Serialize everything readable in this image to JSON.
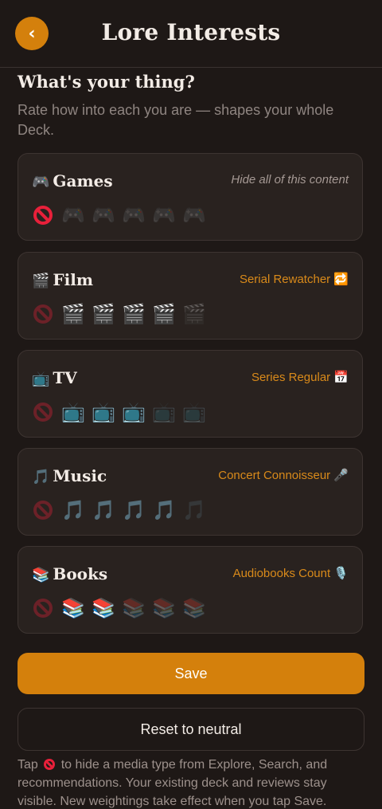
{
  "header": {
    "back_icon": "chevron-left-icon",
    "title": "Lore Interests"
  },
  "intro": {
    "title": "What's your thing?",
    "subtitle": "Rate how into each you are — shapes your whole Deck."
  },
  "categories": [
    {
      "key": "games",
      "emoji": "🎮",
      "label": "Games",
      "status": "Hide all of this content",
      "status_muted": true,
      "glyph": "🎮",
      "hidden": true,
      "level": 0,
      "max": 5
    },
    {
      "key": "film",
      "emoji": "🎬",
      "label": "Film",
      "status": "Serial Rewatcher 🔁",
      "status_muted": false,
      "glyph": "🎬",
      "hidden": false,
      "level": 4,
      "max": 5
    },
    {
      "key": "tv",
      "emoji": "📺",
      "label": "TV",
      "status": "Series Regular 📅",
      "status_muted": false,
      "glyph": "📺",
      "hidden": false,
      "level": 3,
      "max": 5
    },
    {
      "key": "music",
      "emoji": "🎵",
      "label": "Music",
      "status": "Concert Connoisseur 🎤",
      "status_muted": false,
      "glyph": "🎵",
      "hidden": false,
      "level": 4,
      "max": 5
    },
    {
      "key": "books",
      "emoji": "📚",
      "label": "Books",
      "status": "Audiobooks Count 🎙️",
      "status_muted": false,
      "glyph": "📚",
      "hidden": false,
      "level": 2,
      "max": 5
    }
  ],
  "actions": {
    "save_label": "Save",
    "reset_label": "Reset to neutral"
  },
  "footer": {
    "note_prefix": "Tap",
    "note_suffix": "to hide a media type from Explore, Search, and recommendations. Your existing deck and reviews stay visible. New weightings take effect when you tap Save."
  },
  "colors": {
    "accent": "#d4800c",
    "background": "#1e1816",
    "card": "#29221f",
    "hide_red": "#e8203a"
  }
}
